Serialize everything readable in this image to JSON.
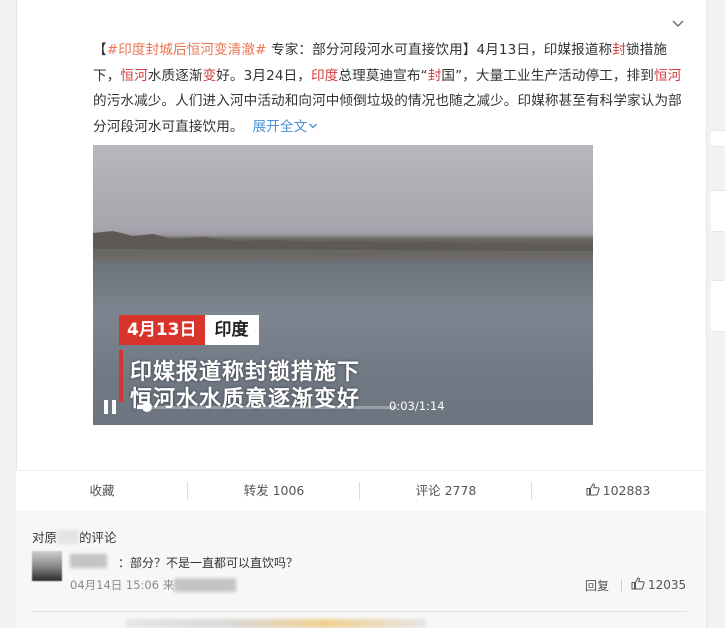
{
  "post": {
    "hashtag": "#印度封城后恒河变清澈#",
    "seg1": " 专家：部分河段河水可直接饮用】4月13日，印媒报道称",
    "kw1": "封",
    "seg2": "锁措施下，",
    "kw2": "恒河",
    "seg3": "水质逐渐",
    "kw3": "变",
    "seg4": "好。3月24日，",
    "kw4": "印度",
    "seg5": "总理莫迪宣布“",
    "kw5": "封",
    "seg6": "国”，大量工业生产活动停工，排到",
    "kw6": "恒河",
    "seg7": "的污水减少。人们进入河中活动和向河中倾倒垃圾的情况也随之减少。印媒称甚至有科学家认为部分河段河水可直接饮用。",
    "expand_label": "展开全文",
    "expand_icon": "chevron-down"
  },
  "video": {
    "date_tag": "4月13日",
    "place_tag": "印度",
    "caption_line1": "印媒报道称封锁措施下",
    "caption_line2": "恒河水水质意逐渐变好",
    "current_time": "0:03",
    "duration": "1:14",
    "time_display": "0:03/1:14",
    "progress": 0.04,
    "accent_color": "#d9342b"
  },
  "actions": {
    "favorite": "收藏",
    "repost": "转发 1006",
    "comment": "评论 2778",
    "like": "102883"
  },
  "comments": {
    "header_prefix": "对原",
    "header_suffix": "的评论",
    "items": [
      {
        "text": "：部分？不是一直都可以直饮吗？",
        "time": "04月14日 15:06 来",
        "reply_label": "回复",
        "likes": "12035"
      }
    ]
  }
}
